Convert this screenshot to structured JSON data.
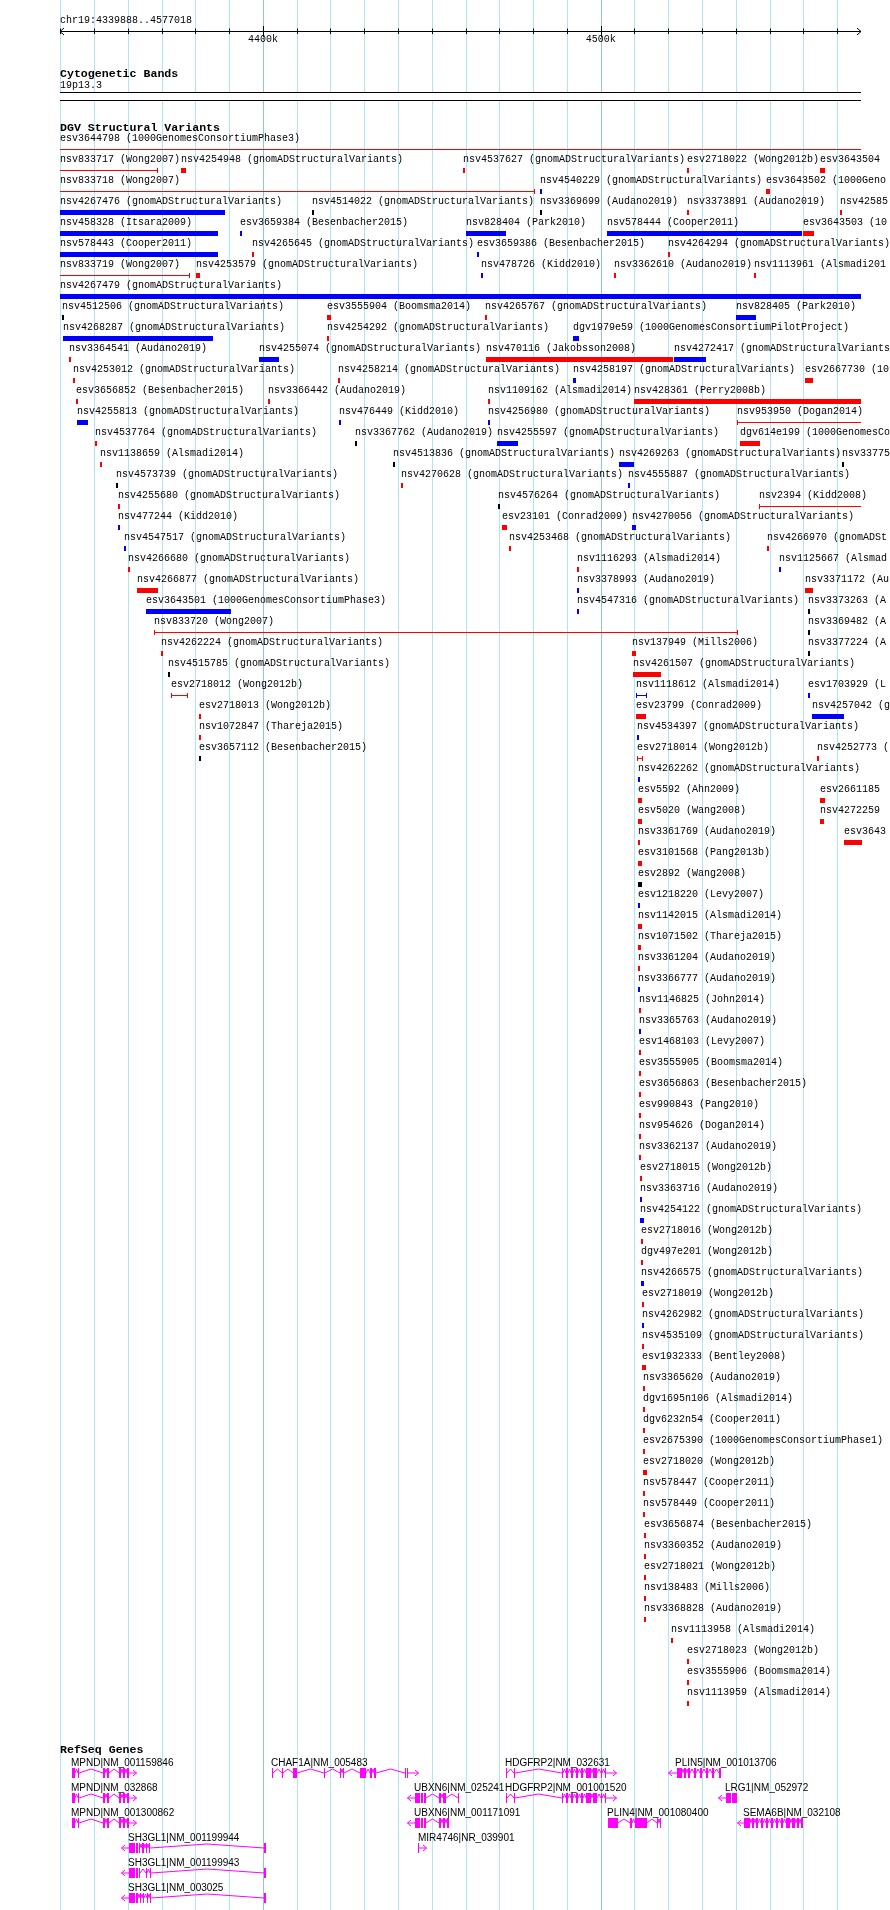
{
  "location": "chr19:4339888..4577018",
  "ruler": {
    "tick_labels": [
      "4400k",
      "4500k"
    ]
  },
  "tracks": [
    {
      "kind": "cytoband",
      "title": "Cytogenetic Bands",
      "band": "19p13.3"
    },
    {
      "kind": "features",
      "title": "DGV Structural Variants",
      "rows": [
        {
          "features": [
            {
              "label": "esv3644798 (1000GenomesConsortiumPhase3)",
              "color": "#ff0000",
              "kind": "span"
            }
          ]
        },
        {
          "features": [
            {
              "label": "nsv833717 (Wong2007)",
              "color": "#ff0000",
              "kind": "span"
            },
            {
              "label": "nsv4254948 (gnomADStructuralVariants)",
              "color": "#ff0000",
              "kind": "bar"
            },
            {
              "label": "nsv4537627 (gnomADStructuralVariants)",
              "color": "#ff0000",
              "kind": "bar"
            },
            {
              "label": "esv2718022 (Wong2012b)",
              "color": "#ff0000",
              "kind": "bar"
            },
            {
              "label": "esv3643504",
              "color": "#ff0000",
              "kind": "bar"
            }
          ]
        },
        {
          "features": [
            {
              "label": "nsv833718 (Wong2007)",
              "color": "#ff0000",
              "kind": "span"
            },
            {
              "label": "nsv4540229 (gnomADStructuralVariants)",
              "color": "#0000ff",
              "kind": "bar"
            },
            {
              "label": "esv3643502 (1000Geno",
              "color": "#ff0000",
              "kind": "bar"
            }
          ]
        },
        {
          "features": [
            {
              "label": "nsv4267476 (gnomADStructuralVariants)",
              "color": "#0000ff",
              "kind": "bar"
            },
            {
              "label": "nsv4514022 (gnomADStructuralVariants)",
              "color": "#000000",
              "kind": "bar"
            },
            {
              "label": "nsv3369699 (Audano2019)",
              "color": "#000000",
              "kind": "bar"
            },
            {
              "label": "nsv3373891 (Audano2019)",
              "color": "#ff0000",
              "kind": "bar"
            },
            {
              "label": "nsv42585",
              "color": "#ff0000",
              "kind": "bar"
            }
          ]
        },
        {
          "features": [
            {
              "label": "nsv458328 (Itsara2009)",
              "color": "#0000ff",
              "kind": "bar"
            },
            {
              "label": "esv3659384 (Besenbacher2015)",
              "color": "#0000ff",
              "kind": "bar"
            },
            {
              "label": "nsv828404 (Park2010)",
              "color": "#0000ff",
              "kind": "bar"
            },
            {
              "label": "nsv578444 (Cooper2011)",
              "color": "#0000ff",
              "kind": "bar"
            },
            {
              "label": "esv3643503 (10",
              "color": "#ff0000",
              "kind": "bar"
            }
          ]
        },
        {
          "features": [
            {
              "label": "nsv578443 (Cooper2011)",
              "color": "#0000ff",
              "kind": "bar"
            },
            {
              "label": "nsv4265645 (gnomADStructuralVariants)",
              "color": "#ff0000",
              "kind": "bar"
            },
            {
              "label": "esv3659386 (Besenbacher2015)",
              "color": "#0000ff",
              "kind": "bar"
            },
            {
              "label": "nsv4264294 (gnomADStructuralVariants)",
              "color": "#ff0000",
              "kind": "bar"
            }
          ]
        },
        {
          "features": [
            {
              "label": "nsv833719 (Wong2007)",
              "color": "#ff0000",
              "kind": "span"
            },
            {
              "label": "nsv4253579 (gnomADStructuralVariants)",
              "color": "#ff0000",
              "kind": "bar"
            },
            {
              "label": "nsv478726 (Kidd2010)",
              "color": "#0000ff",
              "kind": "bar"
            },
            {
              "label": "nsv3362610 (Audano2019)",
              "color": "#ff0000",
              "kind": "bar"
            },
            {
              "label": "nsv1113961 (Alsmadi201",
              "color": "#ff0000",
              "kind": "bar"
            }
          ]
        },
        {
          "features": [
            {
              "label": "nsv4267479 (gnomADStructuralVariants)",
              "color": "#0000ff",
              "kind": "bar"
            }
          ]
        },
        {
          "features": [
            {
              "label": "nsv4512506 (gnomADStructuralVariants)",
              "color": "#000000",
              "kind": "bar"
            },
            {
              "label": "esv3555904 (Boomsma2014)",
              "color": "#ff0000",
              "kind": "bar"
            },
            {
              "label": "nsv4265767 (gnomADStructuralVariants)",
              "color": "#ff0000",
              "kind": "bar"
            },
            {
              "label": "nsv828405 (Park2010)",
              "color": "#0000ff",
              "kind": "bar"
            }
          ]
        },
        {
          "features": [
            {
              "label": "nsv4268287 (gnomADStructuralVariants)",
              "color": "#0000ff",
              "kind": "bar"
            },
            {
              "label": "nsv4254292 (gnomADStructuralVariants)",
              "color": "#ff0000",
              "kind": "bar"
            },
            {
              "label": "dgv1979e59 (1000GenomesConsortiumPilotProject)",
              "color": "#0000ff",
              "kind": "bar"
            }
          ]
        },
        {
          "features": [
            {
              "label": "nsv3364541 (Audano2019)",
              "color": "#ff0000",
              "kind": "bar"
            },
            {
              "label": "nsv4255074 (gnomADStructuralVariants)",
              "color": "#0000ff",
              "kind": "bar"
            },
            {
              "label": "nsv470116 (Jakobsson2008)",
              "color": "#ff0000",
              "kind": "bar"
            },
            {
              "label": "nsv4272417 (gnomADStructuralVariants",
              "color": "#0000ff",
              "kind": "bar"
            }
          ]
        },
        {
          "features": [
            {
              "label": "nsv4253012 (gnomADStructuralVariants)",
              "color": "#ff0000",
              "kind": "bar"
            },
            {
              "label": "nsv4258214 (gnomADStructuralVariants)",
              "color": "#ff0000",
              "kind": "bar"
            },
            {
              "label": "nsv4258197 (gnomADStructuralVariants)",
              "color": "#0000ff",
              "kind": "bar"
            },
            {
              "label": "esv2667730 (10",
              "color": "#ff0000",
              "kind": "bar"
            }
          ]
        },
        {
          "features": [
            {
              "label": "esv3656852 (Besenbacher2015)",
              "color": "#ff0000",
              "kind": "bar"
            },
            {
              "label": "nsv3366442 (Audano2019)",
              "color": "#ff0000",
              "kind": "bar"
            },
            {
              "label": "nsv1109162 (Alsmadi2014)",
              "color": "#ff0000",
              "kind": "bar"
            },
            {
              "label": "nsv428361 (Perry2008b)",
              "color": "#ff0000",
              "kind": "bar"
            }
          ]
        },
        {
          "features": [
            {
              "label": "nsv4255813 (gnomADStructuralVariants)",
              "color": "#0000ff",
              "kind": "bar"
            },
            {
              "label": "nsv476449 (Kidd2010)",
              "color": "#0000ff",
              "kind": "bar"
            },
            {
              "label": "nsv4256980 (gnomADStructuralVariants)",
              "color": "#0000ff",
              "kind": "bar"
            },
            {
              "label": "nsv953950 (Dogan2014)",
              "color": "#ff0000",
              "kind": "span"
            }
          ]
        },
        {
          "features": [
            {
              "label": "nsv4537764 (gnomADStructuralVariants)",
              "color": "#ff0000",
              "kind": "bar"
            },
            {
              "label": "nsv3367762 (Audano2019)",
              "color": "#000000",
              "kind": "bar"
            },
            {
              "label": "nsv4255597 (gnomADStructuralVariants)",
              "color": "#0000ff",
              "kind": "bar"
            },
            {
              "label": "dgv614e199 (1000GenomesCo",
              "color": "#ff0000",
              "kind": "bar"
            }
          ]
        },
        {
          "features": [
            {
              "label": "nsv1138659 (Alsmadi2014)",
              "color": "#ff0000",
              "kind": "bar"
            },
            {
              "label": "nsv4513836 (gnomADStructuralVariants)",
              "color": "#000000",
              "kind": "bar"
            },
            {
              "label": "nsv4269263 (gnomADStructuralVariants)",
              "color": "#0000ff",
              "kind": "bar"
            },
            {
              "label": "nsv33775",
              "color": "#000000",
              "kind": "bar"
            }
          ]
        },
        {
          "features": [
            {
              "label": "nsv4573739 (gnomADStructuralVariants)",
              "color": "#000000",
              "kind": "bar"
            },
            {
              "label": "nsv4270628 (gnomADStructuralVariants)",
              "color": "#ff0000",
              "kind": "bar"
            },
            {
              "label": "nsv4555887 (gnomADStructuralVariants)",
              "color": "#0000ff",
              "kind": "bar"
            }
          ]
        },
        {
          "features": [
            {
              "label": "nsv4255680 (gnomADStructuralVariants)",
              "color": "#ff0000",
              "kind": "bar"
            },
            {
              "label": "nsv4576264 (gnomADStructuralVariants)",
              "color": "#000000",
              "kind": "bar"
            },
            {
              "label": "nsv2394 (Kidd2008)",
              "color": "#ff0000",
              "kind": "span"
            }
          ]
        },
        {
          "features": [
            {
              "label": "nsv477244 (Kidd2010)",
              "color": "#0000ff",
              "kind": "bar"
            },
            {
              "label": "esv23101 (Conrad2009)",
              "color": "#ff0000",
              "kind": "bar"
            },
            {
              "label": "nsv4270056 (gnomADStructuralVariants)",
              "color": "#0000ff",
              "kind": "bar"
            }
          ]
        },
        {
          "features": [
            {
              "label": "nsv4547517 (gnomADStructuralVariants)",
              "color": "#0000ff",
              "kind": "bar"
            },
            {
              "label": "nsv4253468 (gnomADStructuralVariants)",
              "color": "#ff0000",
              "kind": "bar"
            },
            {
              "label": "nsv4266970 (gnomADSt",
              "color": "#ff0000",
              "kind": "bar"
            }
          ]
        },
        {
          "features": [
            {
              "label": "nsv4266680 (gnomADStructuralVariants)",
              "color": "#ff0000",
              "kind": "bar"
            },
            {
              "label": "nsv1116293 (Alsmadi2014)",
              "color": "#ff0000",
              "kind": "bar"
            },
            {
              "label": "nsv1125667 (Alsmad",
              "color": "#0000ff",
              "kind": "bar"
            }
          ]
        },
        {
          "features": [
            {
              "label": "nsv4266877 (gnomADStructuralVariants)",
              "color": "#ff0000",
              "kind": "bar"
            },
            {
              "label": "nsv3378993 (Audano2019)",
              "color": "#0000ff",
              "kind": "bar"
            },
            {
              "label": "nsv3371172 (Au",
              "color": "#ff0000",
              "kind": "bar"
            }
          ]
        },
        {
          "features": [
            {
              "label": "esv3643501 (1000GenomesConsortiumPhase3)",
              "color": "#0000ff",
              "kind": "bar"
            },
            {
              "label": "nsv4547316 (gnomADStructuralVariants)",
              "color": "#0000ff",
              "kind": "bar"
            },
            {
              "label": "nsv3373263 (A",
              "color": "#000000",
              "kind": "bar"
            }
          ]
        },
        {
          "features": [
            {
              "label": "nsv833720 (Wong2007)",
              "color": "#ff0000",
              "kind": "span"
            },
            {
              "label": "nsv3369482 (A",
              "color": "#000000",
              "kind": "bar"
            }
          ]
        },
        {
          "features": [
            {
              "label": "nsv4262224 (gnomADStructuralVariants)",
              "color": "#ff0000",
              "kind": "bar"
            },
            {
              "label": "nsv137949 (Mills2006)",
              "color": "#ff0000",
              "kind": "bar"
            },
            {
              "label": "nsv3377224 (A",
              "color": "#000000",
              "kind": "bar"
            }
          ]
        },
        {
          "features": [
            {
              "label": "nsv4515785 (gnomADStructuralVariants)",
              "color": "#000000",
              "kind": "bar"
            },
            {
              "label": "nsv4261507 (gnomADStructuralVariants)",
              "color": "#ff0000",
              "kind": "bar"
            }
          ]
        },
        {
          "features": [
            {
              "label": "esv2718012 (Wong2012b)",
              "color": "#ff0000",
              "kind": "span"
            },
            {
              "label": "nsv1118612 (Alsmadi2014)",
              "color": "#0000ff",
              "kind": "span"
            },
            {
              "label": "esv1703929 (L",
              "color": "#0000ff",
              "kind": "bar"
            }
          ]
        },
        {
          "features": [
            {
              "label": "esv2718013 (Wong2012b)",
              "color": "#ff0000",
              "kind": "bar"
            },
            {
              "label": "esv23799 (Conrad2009)",
              "color": "#ff0000",
              "kind": "bar"
            },
            {
              "label": "nsv4257042 (g",
              "color": "#0000ff",
              "kind": "bar"
            }
          ]
        },
        {
          "features": [
            {
              "label": "nsv1072847 (Thareja2015)",
              "color": "#ff0000",
              "kind": "bar"
            },
            {
              "label": "nsv4534397 (gnomADStructuralVariants)",
              "color": "#0000ff",
              "kind": "bar"
            }
          ]
        },
        {
          "features": [
            {
              "label": "esv3657112 (Besenbacher2015)",
              "color": "#000000",
              "kind": "bar"
            },
            {
              "label": "esv2718014 (Wong2012b)",
              "color": "#ff0000",
              "kind": "span"
            },
            {
              "label": "nsv4252773 (",
              "color": "#ff0000",
              "kind": "bar"
            }
          ]
        },
        {
          "features": [
            {
              "label": "nsv4262262 (gnomADStructuralVariants)",
              "color": "#0000ff",
              "kind": "bar"
            }
          ]
        },
        {
          "features": [
            {
              "label": "esv5592 (Ahn2009)",
              "color": "#ff0000",
              "kind": "bar"
            },
            {
              "label": "esv2661185",
              "color": "#ff0000",
              "kind": "bar"
            }
          ]
        },
        {
          "features": [
            {
              "label": "esv5020 (Wang2008)",
              "color": "#ff0000",
              "kind": "bar"
            },
            {
              "label": "nsv4272259",
              "color": "#ff0000",
              "kind": "bar"
            }
          ]
        },
        {
          "features": [
            {
              "label": "nsv3361769 (Audano2019)",
              "color": "#ff0000",
              "kind": "bar"
            },
            {
              "label": "esv3643",
              "color": "#ff0000",
              "kind": "bar"
            }
          ]
        },
        {
          "features": [
            {
              "label": "esv3101568 (Pang2013b)",
              "color": "#ff0000",
              "kind": "bar"
            }
          ]
        },
        {
          "features": [
            {
              "label": "esv2892 (Wang2008)",
              "color": "#000000",
              "kind": "bar"
            }
          ]
        },
        {
          "features": [
            {
              "label": "esv1218220 (Levy2007)",
              "color": "#0000ff",
              "kind": "bar"
            }
          ]
        },
        {
          "features": [
            {
              "label": "nsv1142015 (Alsmadi2014)",
              "color": "#ff0000",
              "kind": "bar"
            }
          ]
        },
        {
          "features": [
            {
              "label": "nsv1071502 (Thareja2015)",
              "color": "#ff0000",
              "kind": "bar"
            }
          ]
        },
        {
          "features": [
            {
              "label": "nsv3361204 (Audano2019)",
              "color": "#ff0000",
              "kind": "bar"
            }
          ]
        },
        {
          "features": [
            {
              "label": "nsv3366777 (Audano2019)",
              "color": "#0000ff",
              "kind": "bar"
            }
          ]
        },
        {
          "features": [
            {
              "label": "nsv1146825 (John2014)",
              "color": "#ff0000",
              "kind": "bar"
            }
          ]
        },
        {
          "features": [
            {
              "label": "nsv3365763 (Audano2019)",
              "color": "#0000ff",
              "kind": "bar"
            }
          ]
        },
        {
          "features": [
            {
              "label": "esv1468103 (Levy2007)",
              "color": "#ff0000",
              "kind": "bar"
            }
          ]
        },
        {
          "features": [
            {
              "label": "esv3555905 (Boomsma2014)",
              "color": "#ff0000",
              "kind": "bar"
            }
          ]
        },
        {
          "features": [
            {
              "label": "esv3656863 (Besenbacher2015)",
              "color": "#ff0000",
              "kind": "bar"
            }
          ]
        },
        {
          "features": [
            {
              "label": "esv990843 (Pang2010)",
              "color": "#ff0000",
              "kind": "bar"
            }
          ]
        },
        {
          "features": [
            {
              "label": "nsv954626 (Dogan2014)",
              "color": "#ff0000",
              "kind": "bar"
            }
          ]
        },
        {
          "features": [
            {
              "label": "nsv3362137 (Audano2019)",
              "color": "#ff0000",
              "kind": "bar"
            }
          ]
        },
        {
          "features": [
            {
              "label": "esv2718015 (Wong2012b)",
              "color": "#ff0000",
              "kind": "bar"
            }
          ]
        },
        {
          "features": [
            {
              "label": "nsv3363716 (Audano2019)",
              "color": "#0000ff",
              "kind": "bar"
            }
          ]
        },
        {
          "features": [
            {
              "label": "nsv4254122 (gnomADStructuralVariants)",
              "color": "#0000ff",
              "kind": "bar"
            }
          ]
        },
        {
          "features": [
            {
              "label": "esv2718016 (Wong2012b)",
              "color": "#ff0000",
              "kind": "bar"
            }
          ]
        },
        {
          "features": [
            {
              "label": "dgv497e201 (Wong2012b)",
              "color": "#ff0000",
              "kind": "bar"
            }
          ]
        },
        {
          "features": [
            {
              "label": "nsv4266575 (gnomADStructuralVariants)",
              "color": "#0000ff",
              "kind": "bar"
            }
          ]
        },
        {
          "features": [
            {
              "label": "esv2718019 (Wong2012b)",
              "color": "#ff0000",
              "kind": "bar"
            }
          ]
        },
        {
          "features": [
            {
              "label": "nsv4262982 (gnomADStructuralVariants)",
              "color": "#0000ff",
              "kind": "bar"
            }
          ]
        },
        {
          "features": [
            {
              "label": "nsv4535109 (gnomADStructuralVariants)",
              "color": "#ff0000",
              "kind": "bar"
            }
          ]
        },
        {
          "features": [
            {
              "label": "esv1932333 (Bentley2008)",
              "color": "#ff0000",
              "kind": "bar"
            }
          ]
        },
        {
          "features": [
            {
              "label": "nsv3365620 (Audano2019)",
              "color": "#ff0000",
              "kind": "bar"
            }
          ]
        },
        {
          "features": [
            {
              "label": "dgv1695n106 (Alsmadi2014)",
              "color": "#ff0000",
              "kind": "bar"
            }
          ]
        },
        {
          "features": [
            {
              "label": "dgv6232n54 (Cooper2011)",
              "color": "#ff0000",
              "kind": "bar"
            }
          ]
        },
        {
          "features": [
            {
              "label": "esv2675390 (1000GenomesConsortiumPhase1)",
              "color": "#ff0000",
              "kind": "bar"
            }
          ]
        },
        {
          "features": [
            {
              "label": "esv2718020 (Wong2012b)",
              "color": "#ff0000",
              "kind": "bar"
            }
          ]
        },
        {
          "features": [
            {
              "label": "nsv578447 (Cooper2011)",
              "color": "#ff0000",
              "kind": "bar"
            }
          ]
        },
        {
          "features": [
            {
              "label": "nsv578449 (Cooper2011)",
              "color": "#ff0000",
              "kind": "bar"
            }
          ]
        },
        {
          "features": [
            {
              "label": "esv3656874 (Besenbacher2015)",
              "color": "#ff0000",
              "kind": "bar"
            }
          ]
        },
        {
          "features": [
            {
              "label": "nsv3360352 (Audano2019)",
              "color": "#ff0000",
              "kind": "bar"
            }
          ]
        },
        {
          "features": [
            {
              "label": "esv2718021 (Wong2012b)",
              "color": "#ff0000",
              "kind": "bar"
            }
          ]
        },
        {
          "features": [
            {
              "label": "nsv138483 (Mills2006)",
              "color": "#ff0000",
              "kind": "bar"
            }
          ]
        },
        {
          "features": [
            {
              "label": "nsv3368828 (Audano2019)",
              "color": "#ff0000",
              "kind": "bar"
            }
          ]
        },
        {
          "features": [
            {
              "label": "nsv1113958 (Alsmadi2014)",
              "color": "#ff0000",
              "kind": "bar"
            }
          ]
        },
        {
          "features": [
            {
              "label": "esv2718023 (Wong2012b)",
              "color": "#ff0000",
              "kind": "bar"
            }
          ]
        },
        {
          "features": [
            {
              "label": "esv3555906 (Boomsma2014)",
              "color": "#ff0000",
              "kind": "bar"
            }
          ]
        },
        {
          "features": [
            {
              "label": "nsv1113959 (Alsmadi2014)",
              "color": "#ff0000",
              "kind": "bar"
            }
          ]
        }
      ]
    },
    {
      "kind": "genes",
      "title": "RefSeq Genes",
      "rows": [
        {
          "genes": [
            {
              "label": "MPND|NM_001159846",
              "kind": "forward"
            },
            {
              "label": "CHAF1A|NM_005483",
              "kind": "forward"
            },
            {
              "label": "HDGFRP2|NM_032631",
              "kind": "forward"
            },
            {
              "label": "PLIN5|NM_001013706",
              "kind": "reverse"
            }
          ]
        },
        {
          "genes": [
            {
              "label": "MPND|NM_032868",
              "kind": "forward"
            },
            {
              "label": "UBXN6|NM_025241",
              "kind": "reverse"
            },
            {
              "label": "HDGFRP2|NM_001001520",
              "kind": "forward"
            },
            {
              "label": "LRG1|NM_052972",
              "kind": "reverse"
            }
          ]
        },
        {
          "genes": [
            {
              "label": "MPND|NM_001300862",
              "kind": "forward"
            },
            {
              "label": "UBXN6|NM_001171091",
              "kind": "reverse"
            },
            {
              "label": "PLIN4|NM_001080400",
              "kind": "plain"
            },
            {
              "label": "SEMA6B|NM_032108",
              "kind": "reverse"
            }
          ]
        },
        {
          "genes": [
            {
              "label": "SH3GL1|NM_001199944",
              "kind": "reverse"
            },
            {
              "label": "MIR4746|NR_039901",
              "kind": "forward"
            }
          ]
        },
        {
          "genes": [
            {
              "label": "SH3GL1|NM_001199943",
              "kind": "reverse"
            }
          ]
        },
        {
          "genes": [
            {
              "label": "SH3GL1|NM_003025",
              "kind": "reverse"
            }
          ]
        }
      ]
    }
  ]
}
